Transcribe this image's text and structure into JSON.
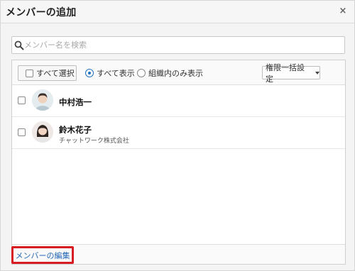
{
  "dialog": {
    "title": "メンバーの追加",
    "close_label": "×"
  },
  "search": {
    "placeholder": "メンバー名を検索"
  },
  "toolbar": {
    "select_all_label": "すべて選択",
    "filter_options": [
      {
        "label": "すべて表示",
        "selected": true
      },
      {
        "label": "組織内のみ表示",
        "selected": false
      }
    ],
    "role_bulk_label": "権限一括設定"
  },
  "members": [
    {
      "name": "中村浩一",
      "org": "",
      "checked": false
    },
    {
      "name": "鈴木花子",
      "org": "チャットワーク株式会社",
      "checked": false
    }
  ],
  "footer": {
    "edit_members_label": "メンバーの編集"
  },
  "colors": {
    "accent_blue": "#2366b5",
    "highlight_red": "#d81c23"
  }
}
